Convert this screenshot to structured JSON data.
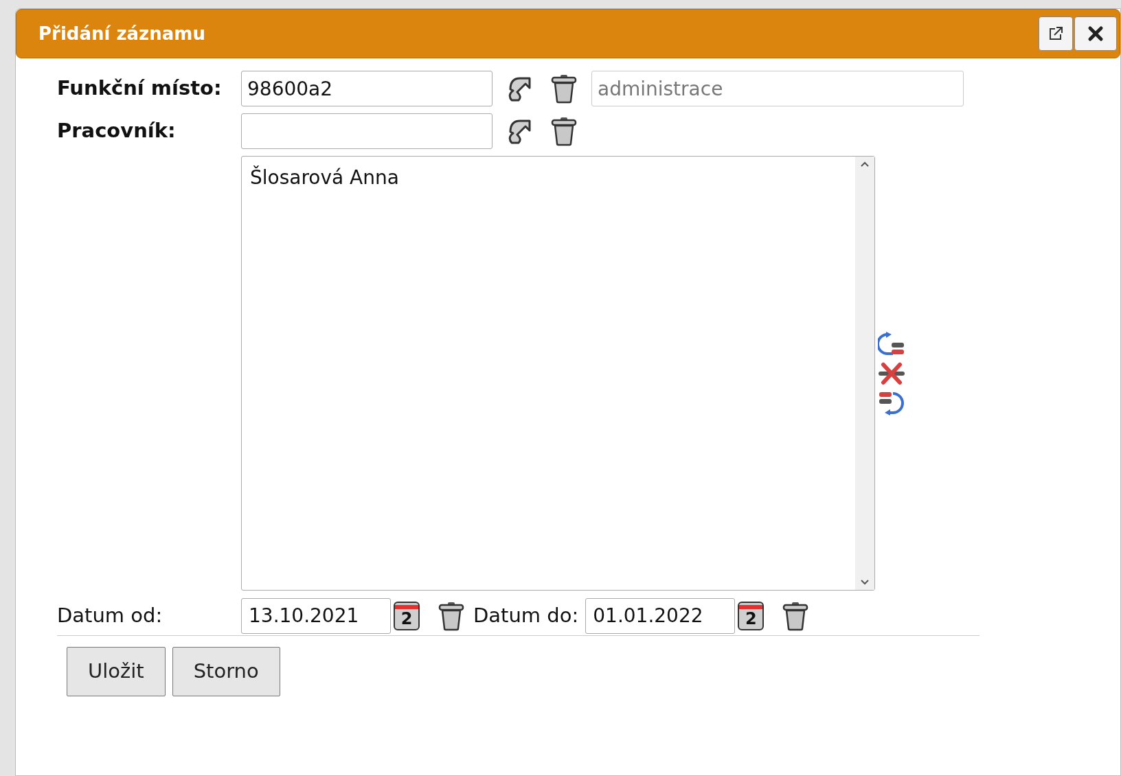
{
  "dialog": {
    "title": "Přidání záznamu"
  },
  "fields": [
    {
      "label": "Funkční místo:",
      "value": "98600a2",
      "description": "administrace"
    },
    {
      "label": "Pracovník:"
    }
  ],
  "worker_list": {
    "items": [
      {
        "text": "Šlosarová Anna",
        "selected": false
      }
    ]
  },
  "dates": [
    {
      "label": "Datum od:",
      "value": "13.10.2021",
      "calendar_day": "2"
    },
    {
      "label": "Datum do:",
      "value": "01.01.2022",
      "calendar_day": "2"
    }
  ],
  "buttons": [
    "Uložit",
    "Storno"
  ]
}
